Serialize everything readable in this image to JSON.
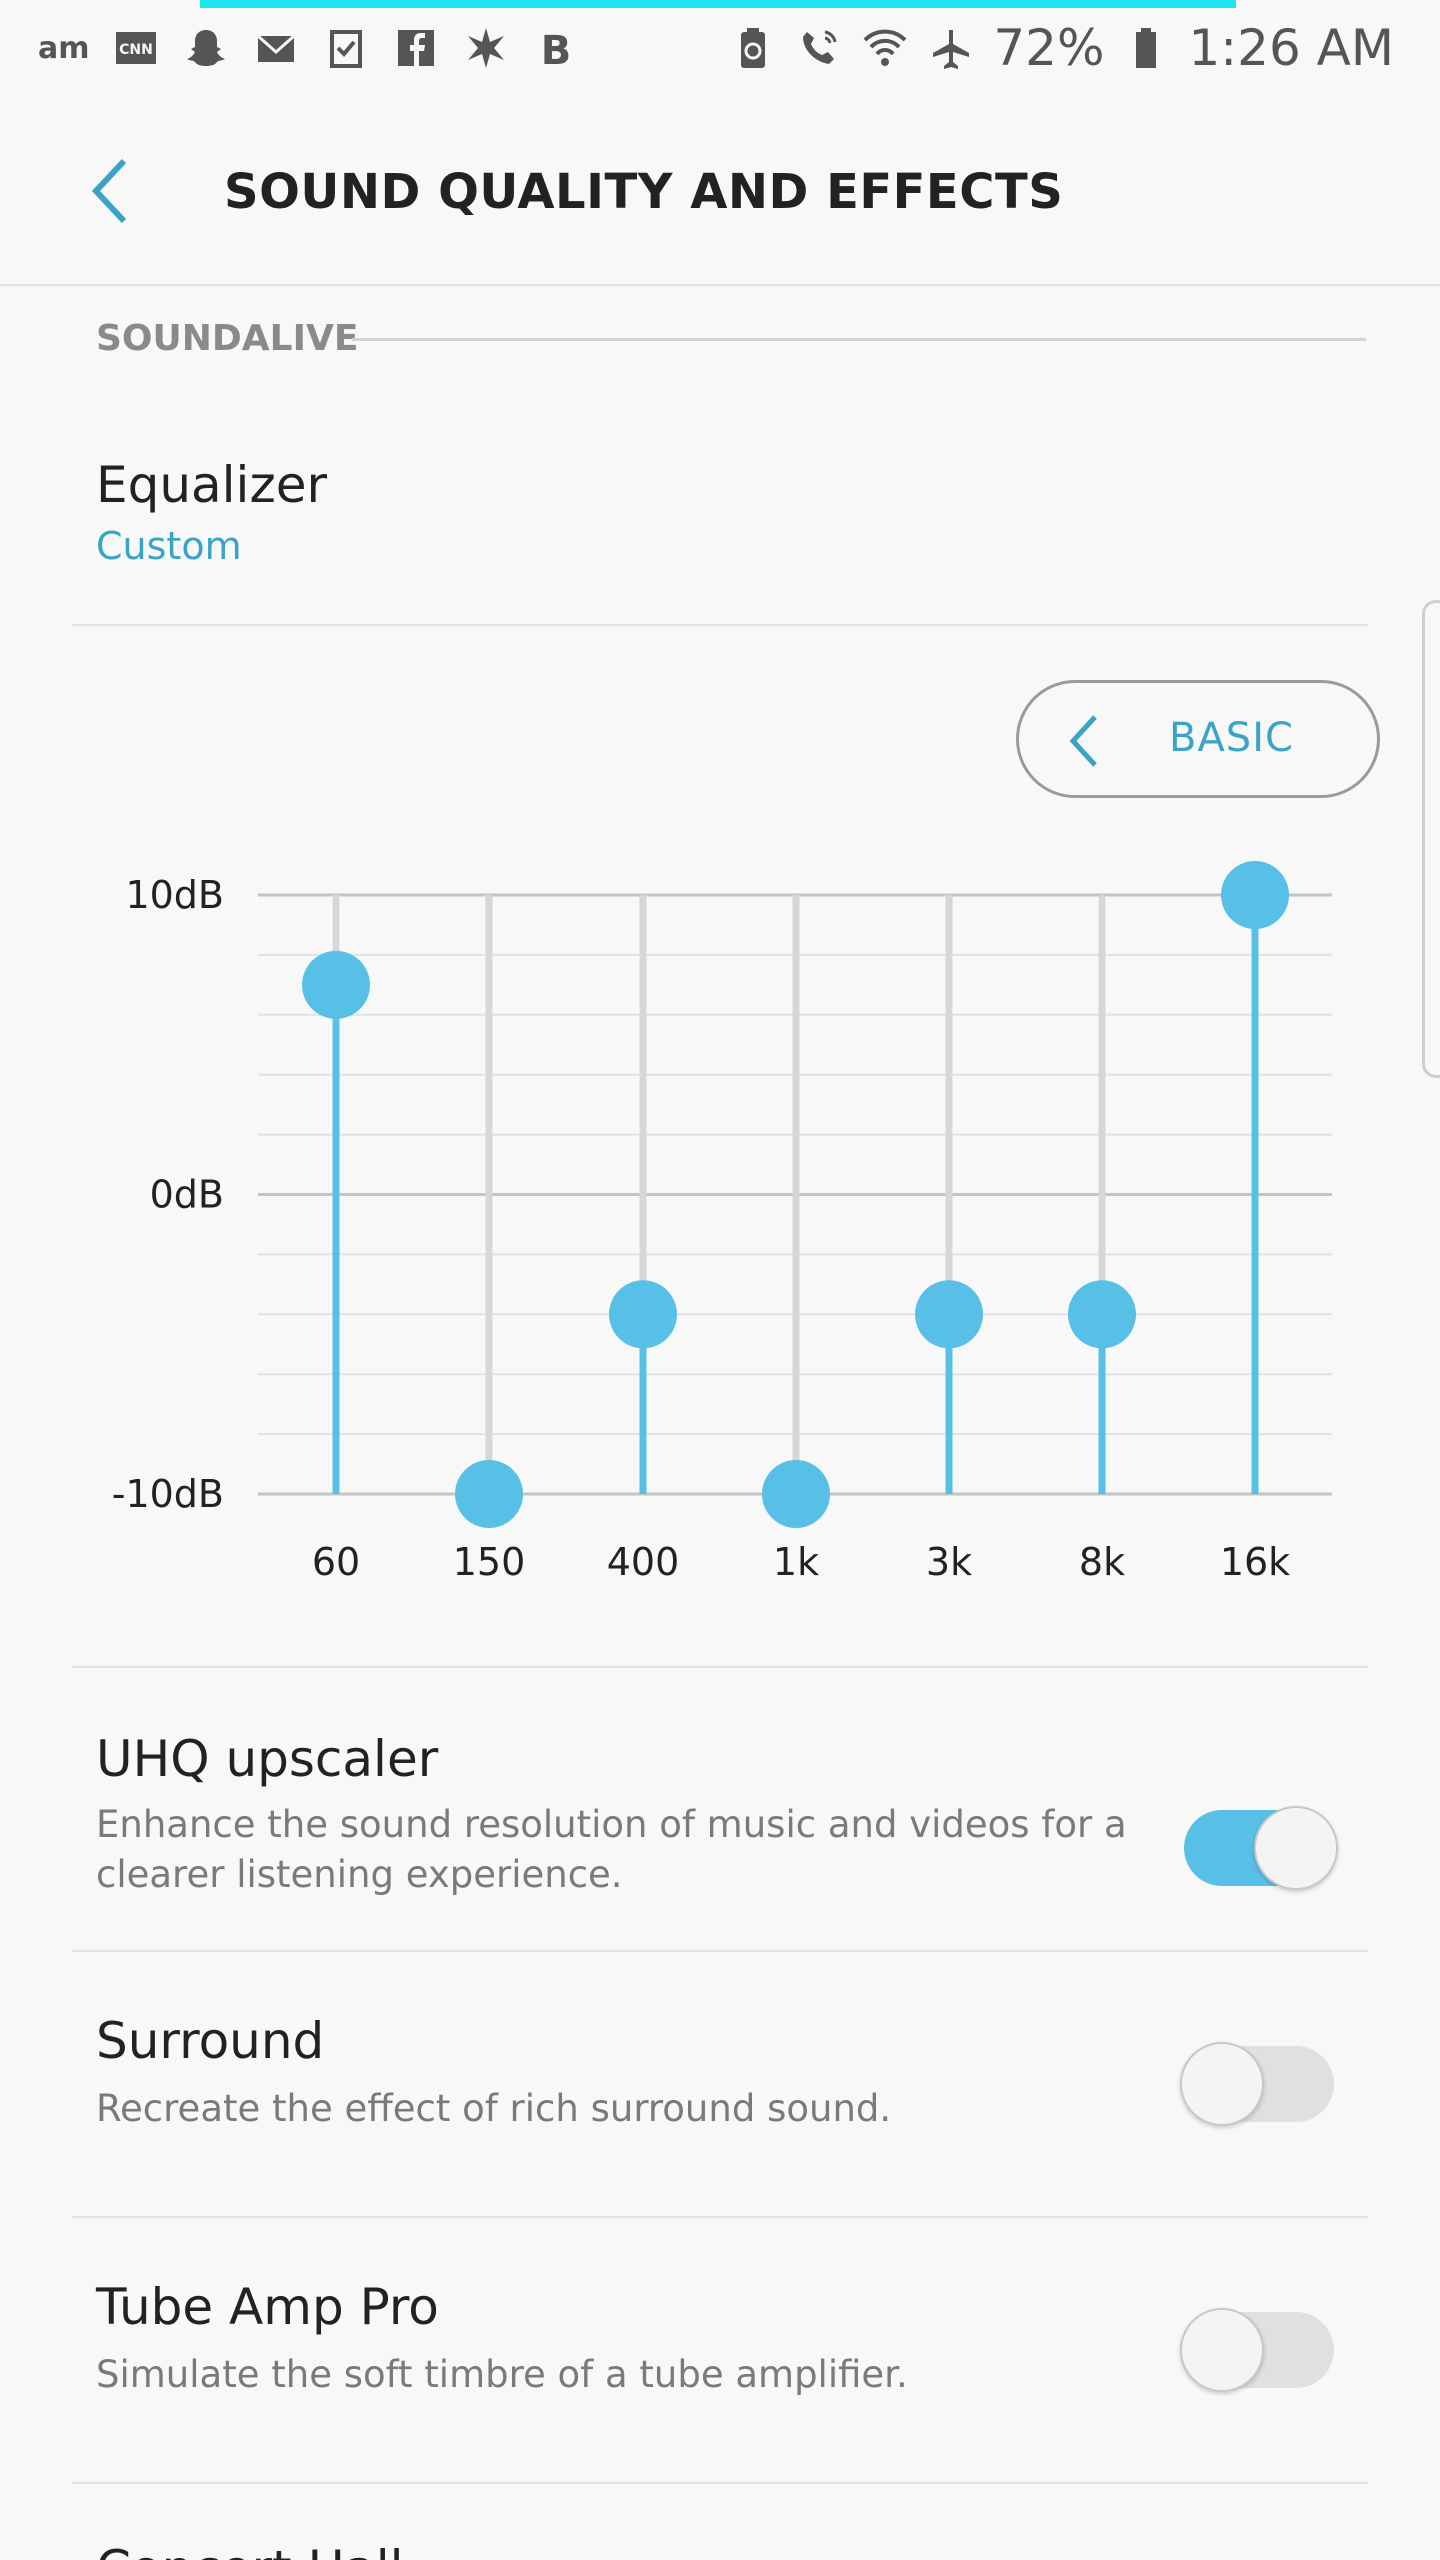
{
  "status_bar": {
    "left_text": "am",
    "icons": [
      "cnn-icon",
      "snapchat-icon",
      "email-icon",
      "task-icon",
      "facebook-icon",
      "starburst-icon",
      "bold-b-icon"
    ],
    "battery_percent": "72%",
    "time": "1:26 AM"
  },
  "header": {
    "title": "SOUND QUALITY AND EFFECTS"
  },
  "section": {
    "label": "SOUNDALIVE"
  },
  "equalizer": {
    "title": "Equalizer",
    "preset": "Custom",
    "mode_button": "BASIC"
  },
  "chart_data": {
    "type": "scatter",
    "x_categories": [
      "60",
      "150",
      "400",
      "1k",
      "3k",
      "8k",
      "16k"
    ],
    "values_db": [
      7,
      -10,
      -4,
      -10,
      -4,
      -4,
      10
    ],
    "y_tick_labels": [
      "10dB",
      "0dB",
      "-10dB"
    ],
    "y_range": [
      -10,
      10
    ],
    "accent_color": "#58c0e6",
    "track_color": "#d7d7d7"
  },
  "settings": [
    {
      "title": "UHQ upscaler",
      "description": "Enhance the sound resolution of music and videos for a clearer listening experience.",
      "enabled": true
    },
    {
      "title": "Surround",
      "description": "Recreate the effect of rich surround sound.",
      "enabled": false
    },
    {
      "title": "Tube Amp Pro",
      "description": "Simulate the soft timbre of a tube amplifier.",
      "enabled": false
    }
  ],
  "partial_next_item": "Concert Hall"
}
